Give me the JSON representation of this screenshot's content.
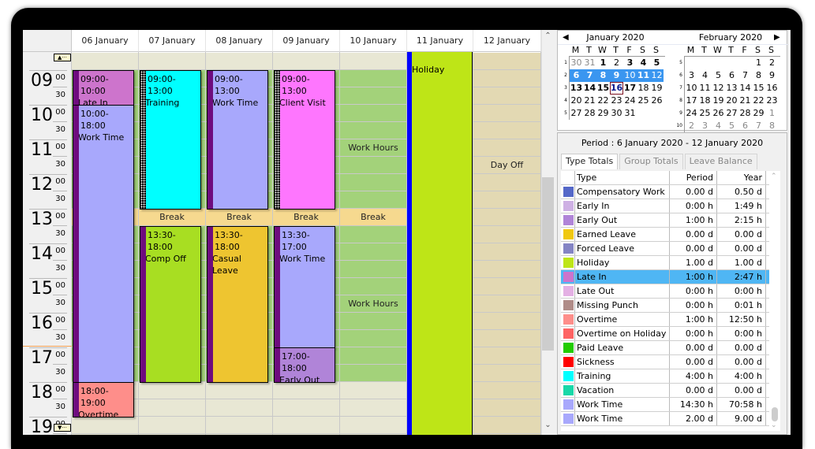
{
  "scheduler": {
    "days": [
      "06 January",
      "07 January",
      "08 January",
      "09 January",
      "10 January",
      "11 January",
      "12 January"
    ],
    "hours": [
      "09",
      "10",
      "11",
      "12",
      "13",
      "14",
      "15",
      "16",
      "17",
      "18",
      "19"
    ],
    "minute_00": "00",
    "minute_30": "30",
    "events": [
      {
        "day": 0,
        "time": "09:00-10:00",
        "name": "Late In",
        "color": "#cd74cc"
      },
      {
        "day": 0,
        "time": "10:00-18:00",
        "name": "Work Time",
        "color": "#a8a8fc"
      },
      {
        "day": 0,
        "time": "18:00-19:00",
        "name": "Overtime",
        "color": "#fe8e8a"
      },
      {
        "day": 1,
        "time": "09:00-13:00",
        "name": "Training",
        "color": "#00ffff"
      },
      {
        "day": 1,
        "time": "13:30-18:00",
        "name": "Comp Off",
        "color": "#a8de22"
      },
      {
        "day": 2,
        "time": "09:00-13:00",
        "name": "Work Time",
        "color": "#a8a8fc"
      },
      {
        "day": 2,
        "time": "13:30-18:00",
        "name": "Casual Leave",
        "color": "#eec530"
      },
      {
        "day": 3,
        "time": "09:00-13:00",
        "name": "Client Visit",
        "color": "#fe76fe"
      },
      {
        "day": 3,
        "time": "13:30-17:00",
        "name": "Work Time",
        "color": "#a8a8fc"
      },
      {
        "day": 3,
        "time": "17:00-18:00",
        "name": "Early Out",
        "color": "#b084d8"
      }
    ],
    "break_label": "Break",
    "work_hours_label": "Work Hours",
    "holiday_label": "Holiday",
    "day_off_label": "Day Off",
    "colors": {
      "work_hours_bg": "#a3d27a",
      "break_bg": "#f6d98f",
      "off_hours_bg": "#e8e7d4",
      "day_off_bg": "#e3d9b3",
      "holiday_bg": "#bee517",
      "holiday_bar": "#0000ff"
    }
  },
  "calendar": {
    "months": [
      {
        "title": "January 2020",
        "weekdays": [
          "M",
          "T",
          "W",
          "T",
          "F",
          "S",
          "S"
        ],
        "weeks": [
          {
            "num": "1",
            "days": [
              {
                "d": "30",
                "s": "gray"
              },
              {
                "d": "31",
                "s": "gray"
              },
              {
                "d": "1",
                "s": "bold"
              },
              {
                "d": "2",
                "s": ""
              },
              {
                "d": "3",
                "s": "bold"
              },
              {
                "d": "4",
                "s": "bold"
              },
              {
                "d": "5",
                "s": "bold"
              }
            ]
          },
          {
            "num": "2",
            "days": [
              {
                "d": "6",
                "s": "sel bold"
              },
              {
                "d": "7",
                "s": "sel bold"
              },
              {
                "d": "8",
                "s": "sel bold"
              },
              {
                "d": "9",
                "s": "sel bold"
              },
              {
                "d": "10",
                "s": "sel"
              },
              {
                "d": "11",
                "s": "sel bold"
              },
              {
                "d": "12",
                "s": "sel"
              }
            ]
          },
          {
            "num": "3",
            "days": [
              {
                "d": "13",
                "s": "bold"
              },
              {
                "d": "14",
                "s": "bold"
              },
              {
                "d": "15",
                "s": "bold"
              },
              {
                "d": "16",
                "s": "today bold"
              },
              {
                "d": "17",
                "s": "bold"
              },
              {
                "d": "18",
                "s": ""
              },
              {
                "d": "19",
                "s": ""
              }
            ]
          },
          {
            "num": "4",
            "days": [
              {
                "d": "20",
                "s": ""
              },
              {
                "d": "21",
                "s": ""
              },
              {
                "d": "22",
                "s": ""
              },
              {
                "d": "23",
                "s": ""
              },
              {
                "d": "24",
                "s": ""
              },
              {
                "d": "25",
                "s": ""
              },
              {
                "d": "26",
                "s": ""
              }
            ]
          },
          {
            "num": "5",
            "days": [
              {
                "d": "27",
                "s": ""
              },
              {
                "d": "28",
                "s": ""
              },
              {
                "d": "29",
                "s": ""
              },
              {
                "d": "30",
                "s": ""
              },
              {
                "d": "31",
                "s": ""
              },
              {
                "d": "",
                "s": ""
              },
              {
                "d": "",
                "s": ""
              }
            ]
          }
        ]
      },
      {
        "title": "February 2020",
        "weekdays": [
          "M",
          "T",
          "W",
          "T",
          "F",
          "S",
          "S"
        ],
        "weeks": [
          {
            "num": "5",
            "days": [
              {
                "d": "",
                "s": ""
              },
              {
                "d": "",
                "s": ""
              },
              {
                "d": "",
                "s": ""
              },
              {
                "d": "",
                "s": ""
              },
              {
                "d": "",
                "s": ""
              },
              {
                "d": "1",
                "s": ""
              },
              {
                "d": "2",
                "s": ""
              }
            ]
          },
          {
            "num": "6",
            "days": [
              {
                "d": "3",
                "s": ""
              },
              {
                "d": "4",
                "s": ""
              },
              {
                "d": "5",
                "s": ""
              },
              {
                "d": "6",
                "s": ""
              },
              {
                "d": "7",
                "s": ""
              },
              {
                "d": "8",
                "s": ""
              },
              {
                "d": "9",
                "s": ""
              }
            ]
          },
          {
            "num": "7",
            "days": [
              {
                "d": "10",
                "s": ""
              },
              {
                "d": "11",
                "s": ""
              },
              {
                "d": "12",
                "s": ""
              },
              {
                "d": "13",
                "s": ""
              },
              {
                "d": "14",
                "s": ""
              },
              {
                "d": "15",
                "s": ""
              },
              {
                "d": "16",
                "s": ""
              }
            ]
          },
          {
            "num": "8",
            "days": [
              {
                "d": "17",
                "s": ""
              },
              {
                "d": "18",
                "s": ""
              },
              {
                "d": "19",
                "s": ""
              },
              {
                "d": "20",
                "s": ""
              },
              {
                "d": "21",
                "s": ""
              },
              {
                "d": "22",
                "s": ""
              },
              {
                "d": "23",
                "s": ""
              }
            ]
          },
          {
            "num": "9",
            "days": [
              {
                "d": "24",
                "s": ""
              },
              {
                "d": "25",
                "s": ""
              },
              {
                "d": "26",
                "s": ""
              },
              {
                "d": "27",
                "s": ""
              },
              {
                "d": "28",
                "s": ""
              },
              {
                "d": "29",
                "s": ""
              },
              {
                "d": "1",
                "s": "gray"
              }
            ]
          },
          {
            "num": "10",
            "days": [
              {
                "d": "2",
                "s": "gray"
              },
              {
                "d": "3",
                "s": "gray"
              },
              {
                "d": "4",
                "s": "gray"
              },
              {
                "d": "5",
                "s": "gray"
              },
              {
                "d": "6",
                "s": "gray"
              },
              {
                "d": "7",
                "s": "gray"
              },
              {
                "d": "8",
                "s": "gray"
              }
            ]
          }
        ]
      }
    ]
  },
  "period": {
    "title": "Period : 6 January 2020 - 12 January 2020",
    "tabs": [
      "Type Totals",
      "Group Totals",
      "Leave Balance"
    ],
    "active_tab": 0,
    "columns": [
      "Type",
      "Period",
      "Year"
    ],
    "rows": [
      {
        "color": "#5568c8",
        "type": "Compensatory Work",
        "period": "0.00 d",
        "year": "0.50 d"
      },
      {
        "color": "#ceb0e4",
        "type": "Early In",
        "period": "0:00 h",
        "year": "1:49 h"
      },
      {
        "color": "#b084d8",
        "type": "Early Out",
        "period": "1:00 h",
        "year": "2:15 h"
      },
      {
        "color": "#f0c810",
        "type": "Earned Leave",
        "period": "0.00 d",
        "year": "0.00 d"
      },
      {
        "color": "#8484c4",
        "type": "Forced Leave",
        "period": "0.00 d",
        "year": "0.00 d"
      },
      {
        "color": "#bee517",
        "type": "Holiday",
        "period": "1.00 d",
        "year": "1.00 d"
      },
      {
        "color": "#cd74cc",
        "type": "Late In",
        "period": "1:00 h",
        "year": "2:47 h",
        "selected": true
      },
      {
        "color": "#e4b0e4",
        "type": "Late Out",
        "period": "0:00 h",
        "year": "0:00 h"
      },
      {
        "color": "#b08c88",
        "type": "Missing Punch",
        "period": "0:00 h",
        "year": "0:01 h"
      },
      {
        "color": "#fe8e8a",
        "type": "Overtime",
        "period": "1:00 h",
        "year": "12:50 h"
      },
      {
        "color": "#fe6464",
        "type": "Overtime on Holiday",
        "period": "0:00 h",
        "year": "0:00 h"
      },
      {
        "color": "#22cc00",
        "type": "Paid Leave",
        "period": "0.00 d",
        "year": "0.00 d"
      },
      {
        "color": "#ff0000",
        "type": "Sickness",
        "period": "0.00 d",
        "year": "0.00 d"
      },
      {
        "color": "#00ffff",
        "type": "Training",
        "period": "4:00 h",
        "year": "4:00 h"
      },
      {
        "color": "#18d8a8",
        "type": "Vacation",
        "period": "0.00 d",
        "year": "0.00 d"
      },
      {
        "color": "#a8a8fc",
        "type": "Work Time",
        "period": "14:30 h",
        "year": "70:58 h"
      },
      {
        "color": "#a8a8fc",
        "type": "Work Time",
        "period": "2.00 d",
        "year": "9.00 d"
      }
    ]
  }
}
